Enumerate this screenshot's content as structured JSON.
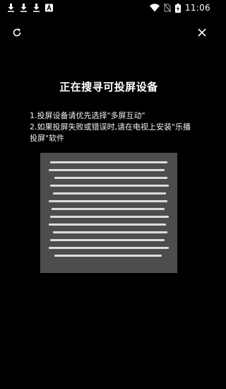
{
  "status_bar": {
    "time": "11:06",
    "icons": [
      "download-icon",
      "download-icon",
      "download-icon",
      "font-app-icon",
      "wifi-icon",
      "no-sim-icon",
      "battery-charging-icon"
    ]
  },
  "toolbar": {
    "refresh_icon": "refresh-icon",
    "close_icon": "close-icon"
  },
  "main": {
    "title": "正在搜寻可投屏设备",
    "instructions": [
      "1.投屏设备请优先选择\"多屏互动\"",
      "2.如果投屏失败或错误时,请在电视上安装\"乐播投屏\"软件"
    ]
  },
  "colors": {
    "background": "#000000",
    "illustration_bg": "#4d4d4d",
    "line": "#dcdcdc"
  }
}
